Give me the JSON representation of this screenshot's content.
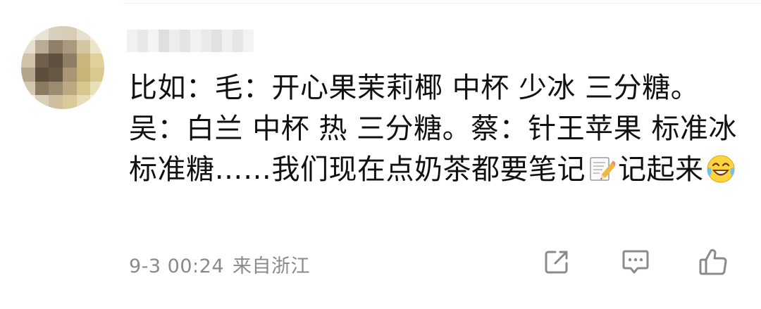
{
  "comment": {
    "segments": [
      "比如：毛：开心果茉莉椰 中杯 少冰 三分糖。吴：白兰 中杯 热 三分糖。蔡：针王苹果 标准冰 标准糖……我们现在点奶茶都要笔记",
      "记起来"
    ],
    "emojis": [
      "memo-emoji",
      "laughing-crying-emoji"
    ]
  },
  "meta": {
    "timestamp": "9-3 00:24",
    "location": "来自浙江"
  },
  "actions": {
    "icons": [
      "share-icon",
      "reply-icon",
      "like-icon"
    ]
  },
  "colors": {
    "text": "#111111",
    "meta": "#8a8a8a",
    "icon": "#8a8a8a"
  }
}
